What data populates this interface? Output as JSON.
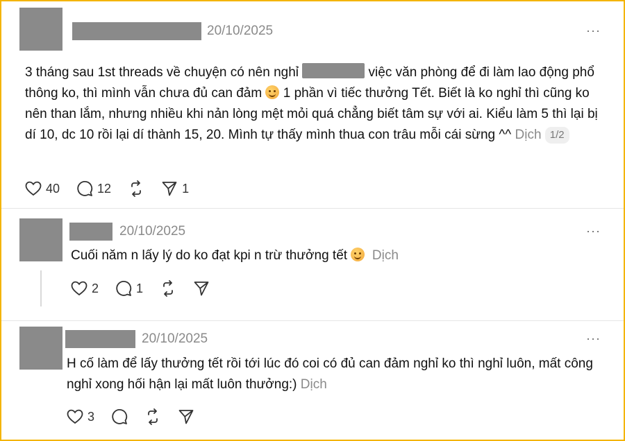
{
  "post": {
    "time": "20/10/2025",
    "more": "···",
    "text_part1": "3 tháng sau 1st threads về chuyện có nên nghỉ ",
    "text_part2": " việc văn phòng để đi làm lao động phổ thông ko, thì mình vẫn chưa đủ can đảm ",
    "text_part3": " 1 phần vì tiếc thưởng Tết. Biết là ko nghỉ thì cũng ko nên than lắm, nhưng nhiều khi nản lòng mệt mỏi quá chẳng biết tâm sự với ai. Kiểu làm 5 thì lại bị dí 10, dc 10 rồi lại dí thành 15, 20. Mình tự thấy mình thua con trâu mỗi cái sừng ^^ ",
    "translate": "Dịch",
    "pager": "1/2",
    "likes": "40",
    "comments": "12",
    "reposts": "",
    "shares": "1"
  },
  "reply1": {
    "time": "20/10/2025",
    "more": "···",
    "text": "Cuối năm n lấy lý do ko đạt kpi n trừ thưởng tết ",
    "translate": "Dịch",
    "likes": "2",
    "comments": "1"
  },
  "reply2": {
    "time": "20/10/2025",
    "more": "···",
    "text": "H cố làm để lấy thưởng tết rồi tới lúc đó coi có đủ can đảm nghỉ ko thì nghỉ luôn, mất công nghỉ xong hối hận lại mất luôn thưởng:) ",
    "translate": "Dịch",
    "likes": "3"
  },
  "colors": {
    "accent_border": "#f4b400",
    "redaction": "#8a8a8a"
  }
}
